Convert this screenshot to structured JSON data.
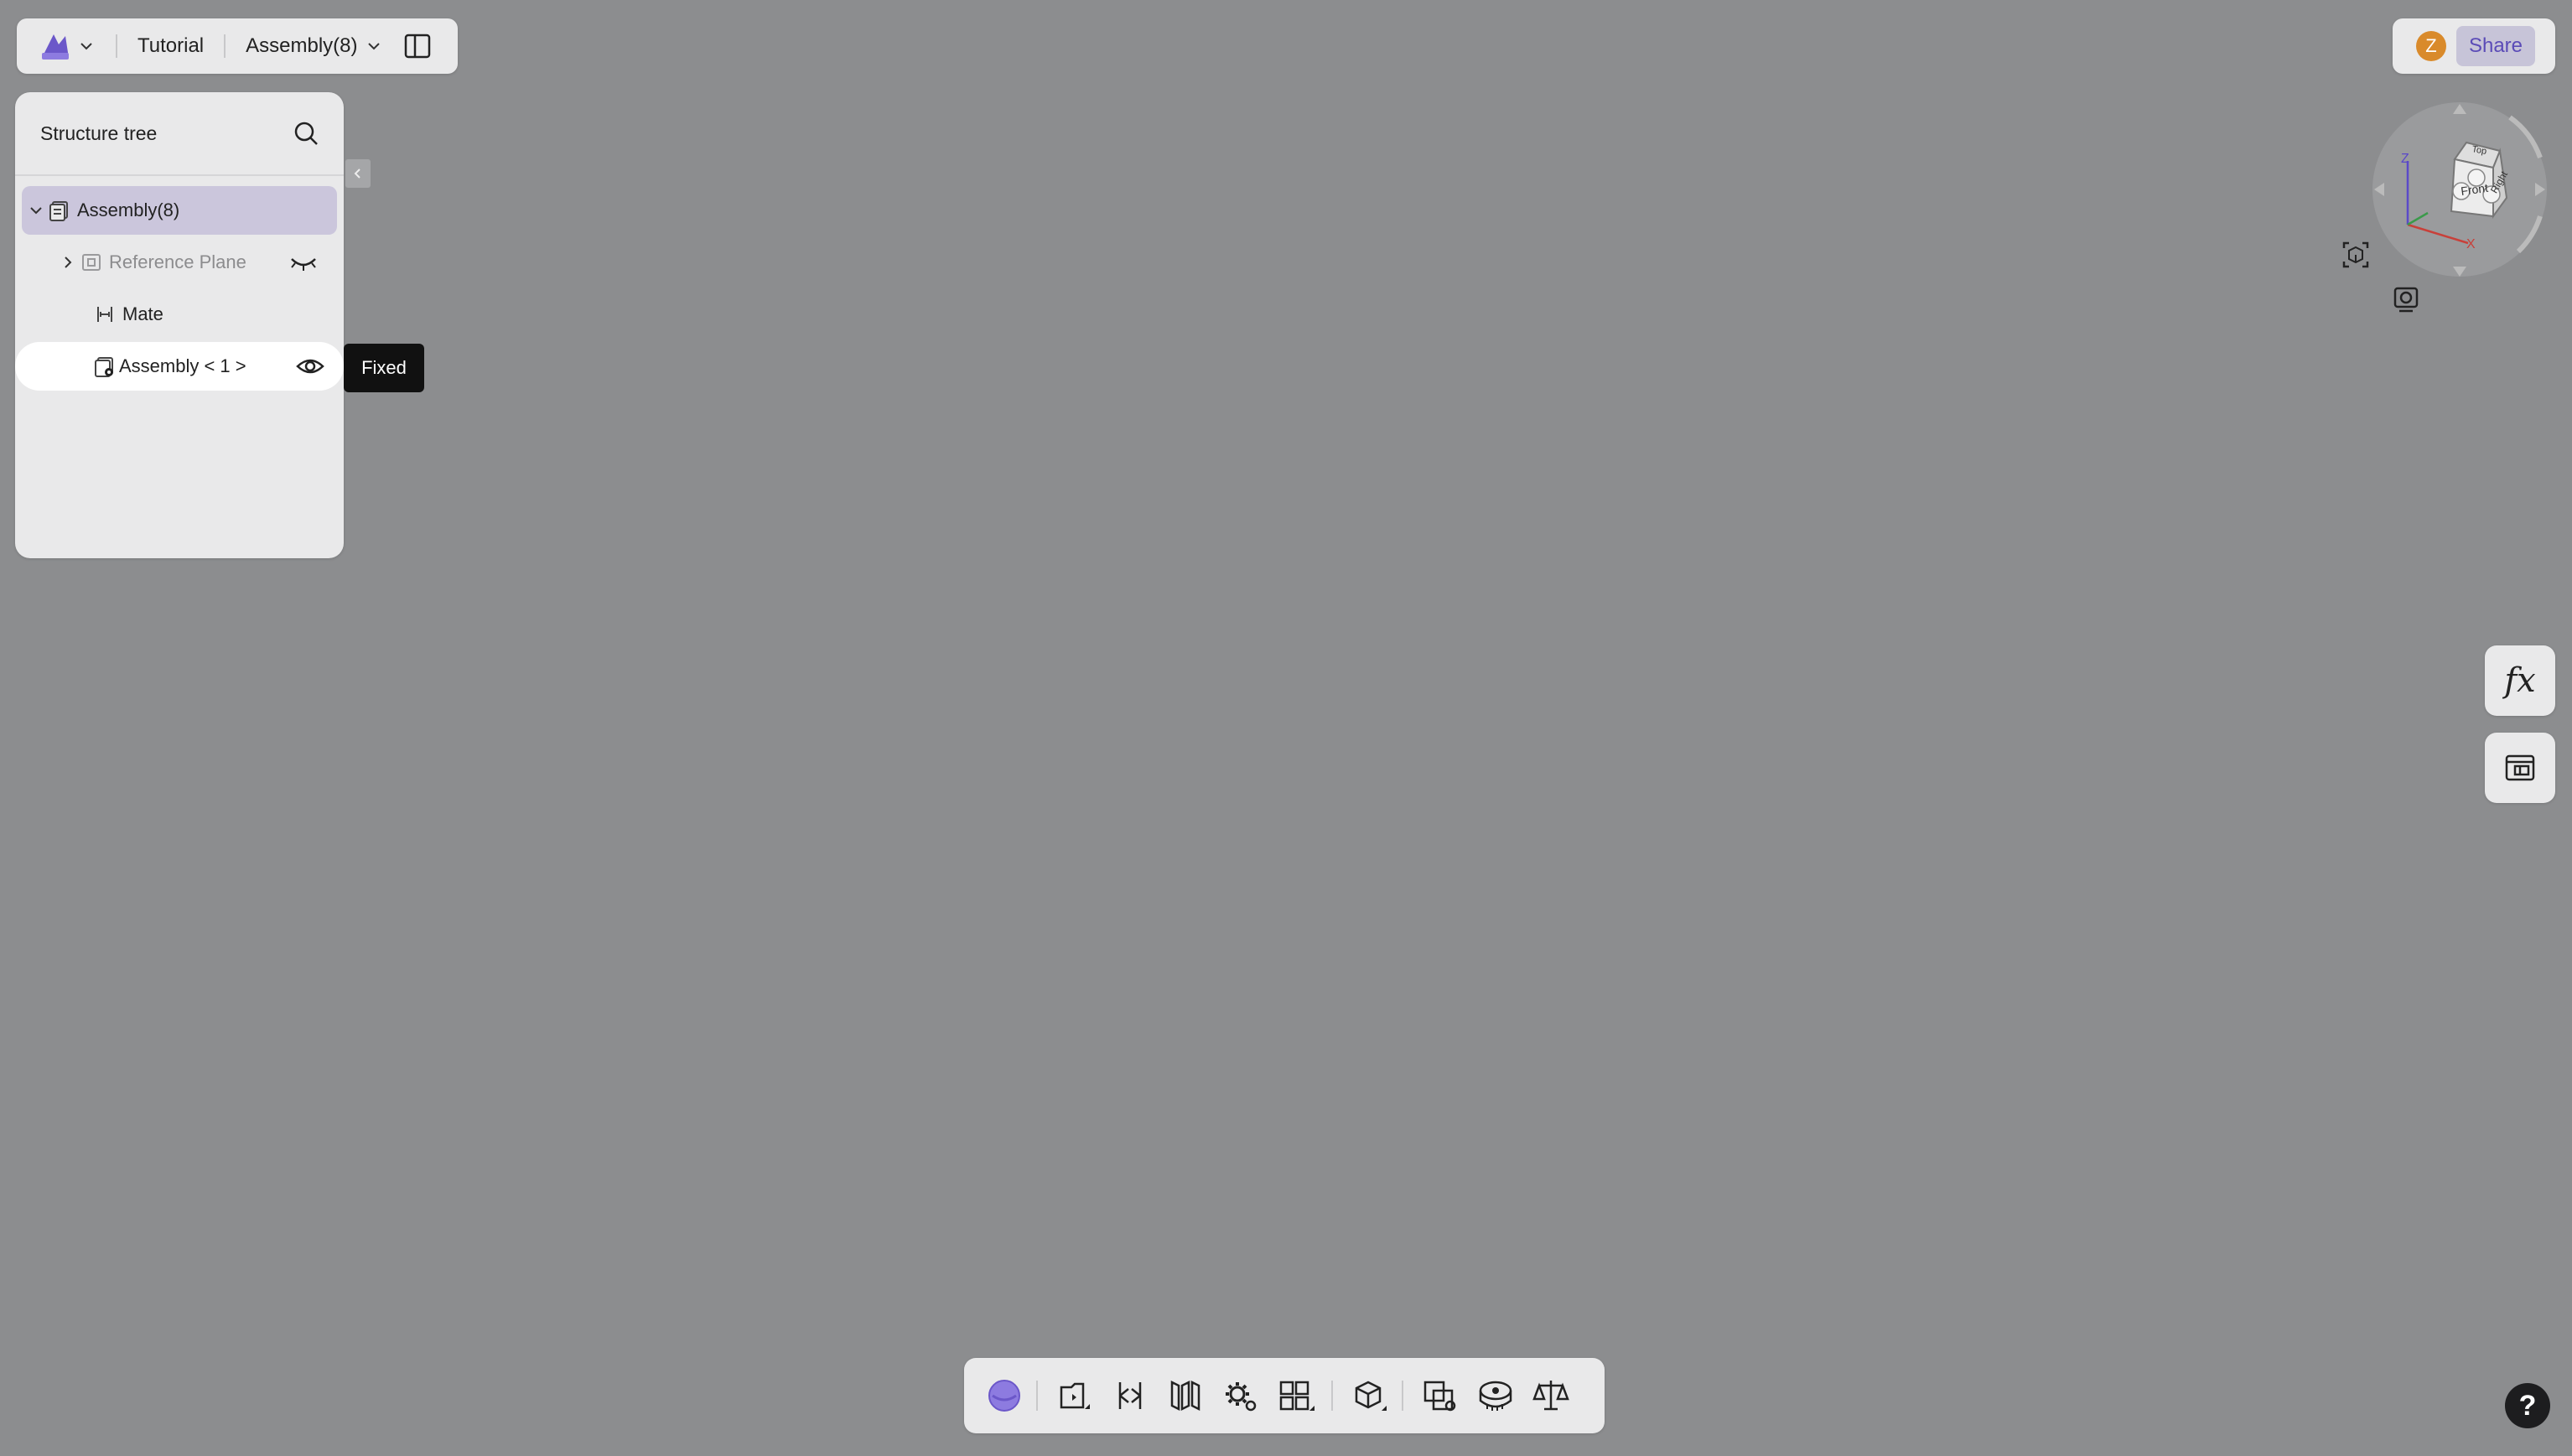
{
  "header": {
    "logo_icon": "app-logo-icon",
    "crumb_tutorial": "Tutorial",
    "document_name": "Assembly(8)",
    "share_label": "Share",
    "avatar_letter": "Z"
  },
  "tree": {
    "title": "Structure tree",
    "items": [
      {
        "label": "Assembly(8)"
      },
      {
        "label": "Reference Plane"
      },
      {
        "label": "Mate"
      },
      {
        "label": "Assembly < 1 >"
      }
    ],
    "tooltip": "Fixed"
  },
  "viewcube": {
    "faces": {
      "top": "Top",
      "front": "Front",
      "right": "Right"
    },
    "axes": {
      "x": "X",
      "z": "Z"
    }
  },
  "colors": {
    "accent": "#6b57c9",
    "background": "#8c8d8f",
    "panel": "#e9e9ea",
    "avatar": "#d98a2b"
  },
  "help_label": "?",
  "fx_label": "fx"
}
